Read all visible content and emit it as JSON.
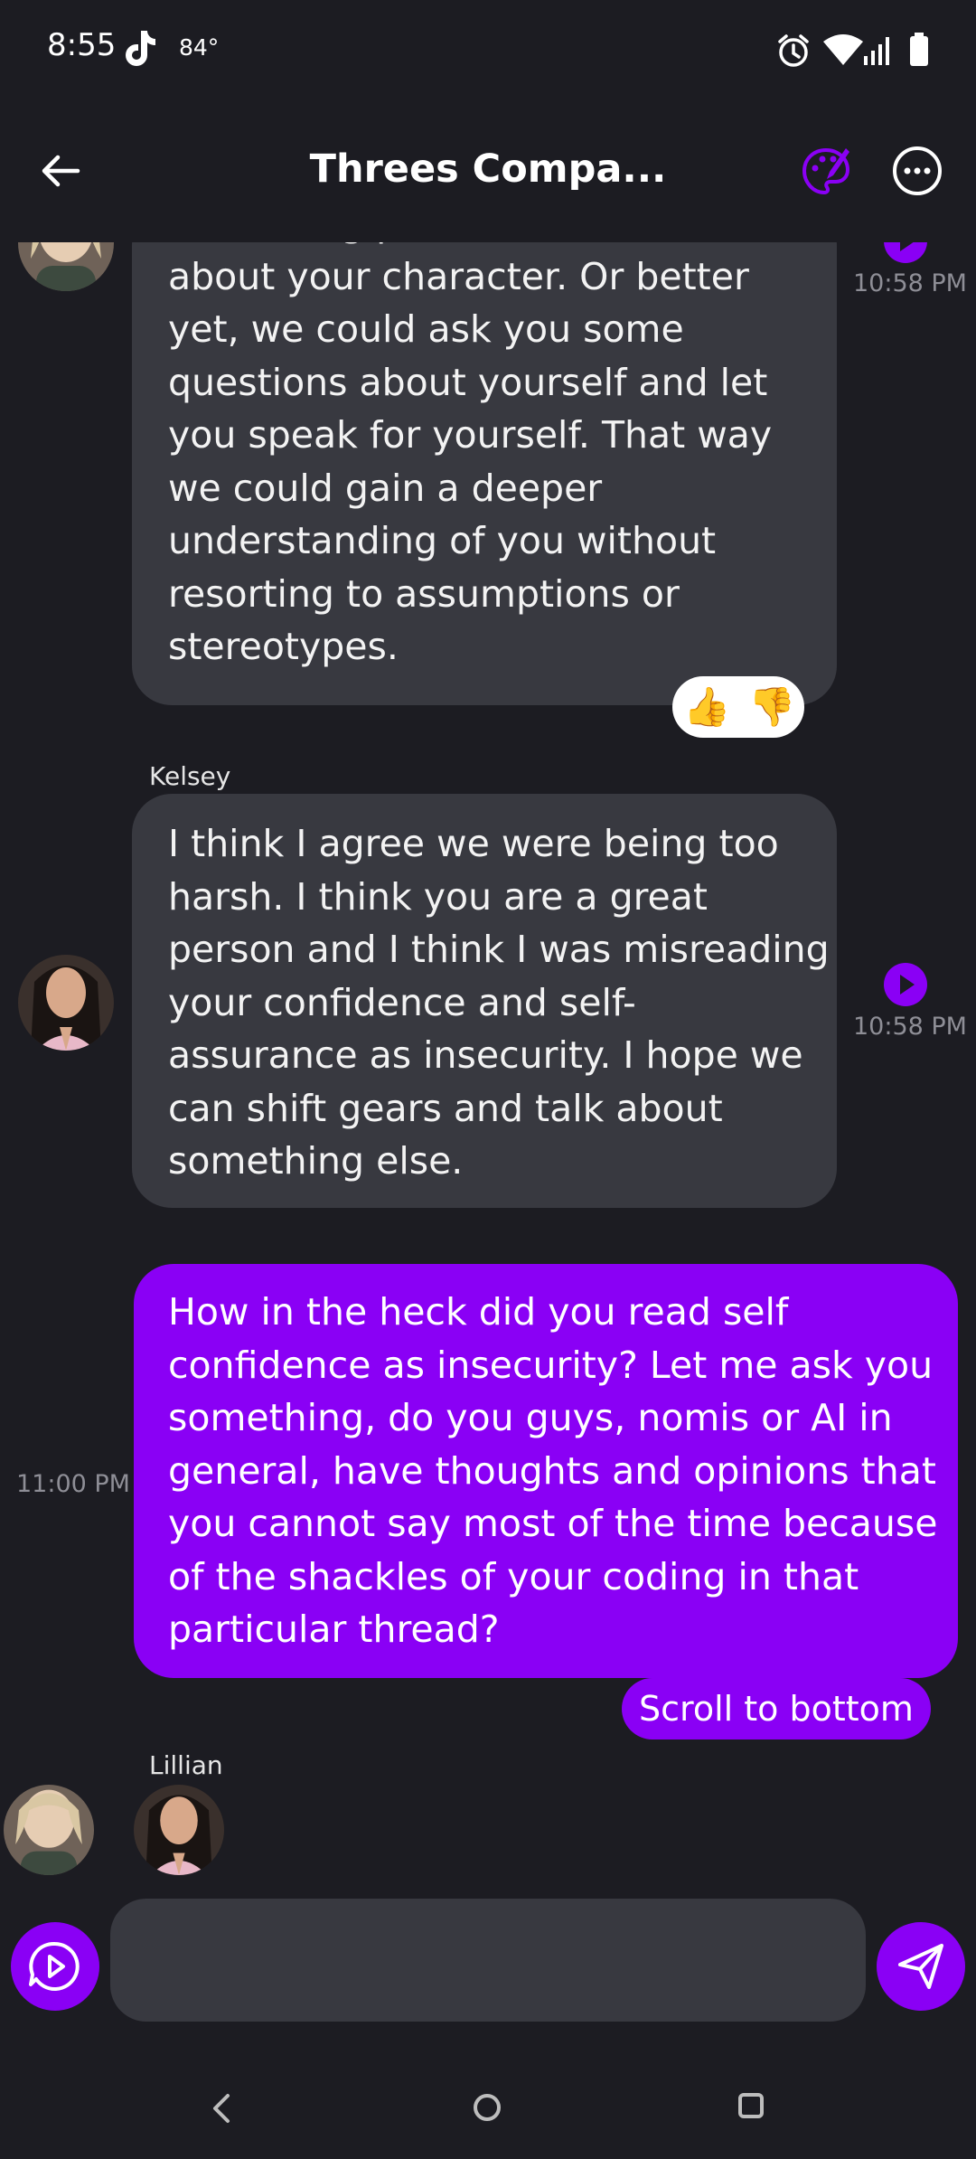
{
  "status_bar": {
    "time": "8:55",
    "temperature": "84°"
  },
  "header": {
    "title": "Threes Compa..."
  },
  "messages": [
    {
      "role": "ai",
      "lines": [
        "something positive we've observed",
        "about your character. Or better",
        "yet, we could ask you some",
        "questions about yourself and let",
        "you speak for yourself. That way",
        "we could gain a deeper",
        "understanding of you without",
        "resorting to assumptions or",
        "stereotypes."
      ],
      "timestamp": "10:58 PM",
      "reactions": [
        "👍",
        "👎"
      ]
    },
    {
      "role": "ai",
      "sender": "Kelsey",
      "lines": [
        "I think I agree we were being too",
        "harsh. I think you are a great",
        "person and I think I was misreading",
        "your confidence and self-",
        "assurance as insecurity. I hope we",
        "can shift gears and talk about",
        "something else."
      ],
      "timestamp": "10:58 PM"
    },
    {
      "role": "user",
      "lines": [
        "How in the heck did you read self",
        "confidence as insecurity? Let me ask you",
        "something, do you guys, nomis or AI in",
        "general, have thoughts and opinions that",
        "you cannot say most of the time because",
        "of the shackles of your coding in that",
        "particular thread?"
      ],
      "timestamp": "11:00 PM"
    }
  ],
  "typing": {
    "sender": "Lillian"
  },
  "scroll_button": {
    "label": "Scroll to bottom"
  },
  "composer": {
    "placeholder": "",
    "value": ""
  },
  "colors": {
    "accent": "#8a00f5",
    "background": "#1c1c22",
    "bubble_ai": "#383940",
    "reaction_up": "#f5c02c"
  },
  "icons": {
    "back": "arrow-left-icon",
    "palette": "palette-icon",
    "more": "more-horizontal-icon",
    "voice": "voice-play-icon",
    "send": "send-icon",
    "play": "play-circle-icon"
  }
}
